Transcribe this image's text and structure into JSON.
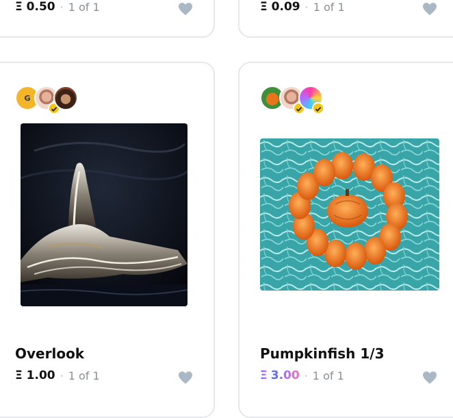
{
  "cards": [
    {
      "price": "Ξ 0.50",
      "edition": "1 of 1"
    },
    {
      "price": "Ξ 0.09",
      "edition": "1 of 1"
    },
    {
      "title": "Overlook",
      "price": "Ξ 1.00",
      "edition": "1 of 1",
      "avatar_letter": "G"
    },
    {
      "title": "Pumpkinfish 1/3",
      "price_symbol": "Ξ",
      "price_value": "3.00",
      "edition": "1 of 1"
    }
  ],
  "separator": "·",
  "colors": {
    "heart": "#aab8c6",
    "border": "#e5e7ea",
    "badge": "#f5c518",
    "muted": "#8a8f96"
  },
  "icons": {
    "like": "heart-icon",
    "verified": "check-badge-icon"
  }
}
